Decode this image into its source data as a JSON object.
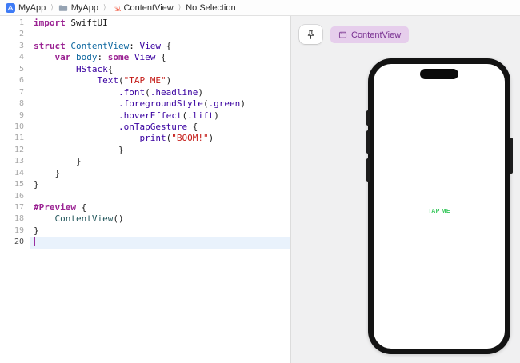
{
  "colors": {
    "keyword": "#9B2393",
    "sdk": "#3900A0",
    "declaration": "#0F68A0",
    "project_ref": "#23575C",
    "string": "#C41A16",
    "plain": "#1B1B1B",
    "current_line_bg": "#E9F2FC",
    "cursor": "#9A2FA0",
    "chip_bg": "#E6CEEC",
    "chip_text": "#7A3292",
    "preview_green": "#34C759"
  },
  "breadcrumb": {
    "separator": "⟩",
    "items": [
      {
        "icon": "app-icon",
        "label": "MyApp"
      },
      {
        "icon": "folder-icon",
        "label": "MyApp"
      },
      {
        "icon": "swift-file-icon",
        "label": "ContentView"
      },
      {
        "icon": null,
        "label": "No Selection"
      }
    ]
  },
  "editor": {
    "current_line": 20,
    "lines": [
      {
        "n": 1,
        "tokens": [
          [
            "k",
            "import"
          ],
          [
            "p",
            " SwiftUI"
          ]
        ]
      },
      {
        "n": 2,
        "tokens": []
      },
      {
        "n": 3,
        "tokens": [
          [
            "k",
            "struct"
          ],
          [
            "p",
            " "
          ],
          [
            "d",
            "ContentView"
          ],
          [
            "p",
            ": "
          ],
          [
            "t",
            "View"
          ],
          [
            "p",
            " {"
          ]
        ]
      },
      {
        "n": 4,
        "tokens": [
          [
            "p",
            "    "
          ],
          [
            "k",
            "var"
          ],
          [
            "p",
            " "
          ],
          [
            "d",
            "body"
          ],
          [
            "p",
            ": "
          ],
          [
            "k",
            "some"
          ],
          [
            "p",
            " "
          ],
          [
            "t",
            "View"
          ],
          [
            "p",
            " {"
          ]
        ]
      },
      {
        "n": 5,
        "tokens": [
          [
            "p",
            "        "
          ],
          [
            "t",
            "HStack"
          ],
          [
            "p",
            "{"
          ]
        ]
      },
      {
        "n": 6,
        "tokens": [
          [
            "p",
            "            "
          ],
          [
            "t",
            "Text"
          ],
          [
            "p",
            "("
          ],
          [
            "s",
            "\"TAP ME\""
          ],
          [
            "p",
            ")"
          ]
        ]
      },
      {
        "n": 7,
        "tokens": [
          [
            "p",
            "                "
          ],
          [
            "t",
            ".font"
          ],
          [
            "p",
            "("
          ],
          [
            "t",
            ".headline"
          ],
          [
            "p",
            ")"
          ]
        ]
      },
      {
        "n": 8,
        "tokens": [
          [
            "p",
            "                "
          ],
          [
            "t",
            ".foregroundStyle"
          ],
          [
            "p",
            "("
          ],
          [
            "t",
            ".green"
          ],
          [
            "p",
            ")"
          ]
        ]
      },
      {
        "n": 9,
        "tokens": [
          [
            "p",
            "                "
          ],
          [
            "t",
            ".hoverEffect"
          ],
          [
            "p",
            "("
          ],
          [
            "t",
            ".lift"
          ],
          [
            "p",
            ")"
          ]
        ]
      },
      {
        "n": 10,
        "tokens": [
          [
            "p",
            "                "
          ],
          [
            "t",
            ".onTapGesture"
          ],
          [
            "p",
            " {"
          ]
        ]
      },
      {
        "n": 11,
        "tokens": [
          [
            "p",
            "                    "
          ],
          [
            "t",
            "print"
          ],
          [
            "p",
            "("
          ],
          [
            "s",
            "\"BOOM!\""
          ],
          [
            "p",
            ")"
          ]
        ]
      },
      {
        "n": 12,
        "tokens": [
          [
            "p",
            "                }"
          ]
        ]
      },
      {
        "n": 13,
        "tokens": [
          [
            "p",
            "        }"
          ]
        ]
      },
      {
        "n": 14,
        "tokens": [
          [
            "p",
            "    }"
          ]
        ]
      },
      {
        "n": 15,
        "tokens": [
          [
            "p",
            "}"
          ]
        ]
      },
      {
        "n": 16,
        "tokens": []
      },
      {
        "n": 17,
        "tokens": [
          [
            "k",
            "#Preview"
          ],
          [
            "p",
            " {"
          ]
        ]
      },
      {
        "n": 18,
        "tokens": [
          [
            "p",
            "    "
          ],
          [
            "r",
            "ContentView"
          ],
          [
            "p",
            "()"
          ]
        ]
      },
      {
        "n": 19,
        "tokens": [
          [
            "p",
            "}"
          ]
        ]
      },
      {
        "n": 20,
        "tokens": []
      }
    ]
  },
  "canvas": {
    "pin_button": {
      "icon": "pin-icon"
    },
    "preview_chip": {
      "icon": "box-icon",
      "label": "ContentView"
    },
    "device": {
      "screen_text": "TAP ME"
    }
  }
}
